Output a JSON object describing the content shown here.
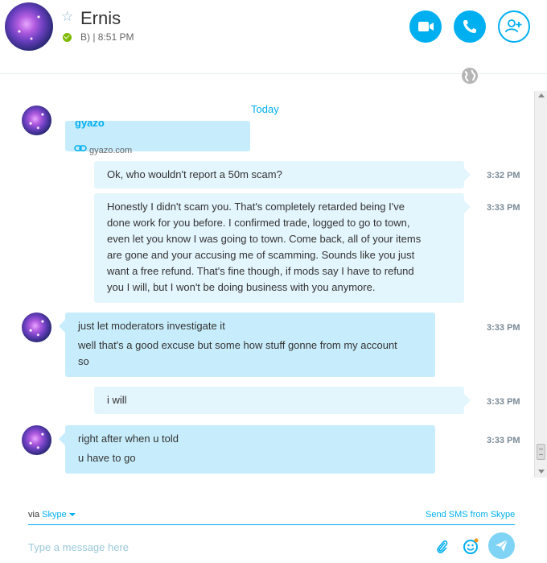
{
  "header": {
    "contact_name": "Ernis",
    "mood": "B) | 8:51 PM",
    "accent_color": "#00aff0",
    "presence_color": "#7fba00",
    "icons": [
      "star-icon",
      "video-icon",
      "phone-icon",
      "add-contact-icon",
      "globe-icon"
    ]
  },
  "conversation": {
    "day_separator": "Today",
    "link_preview": {
      "title": "gyazo",
      "domain": "gyazo.com"
    },
    "messages": [
      {
        "direction": "outgoing",
        "time": "3:32 PM",
        "lines": [
          "Ok, who wouldn't report a 50m scam?"
        ]
      },
      {
        "direction": "outgoing",
        "time": "3:33 PM",
        "lines": [
          "Honestly I didn't scam you. That's completely retarded being I've",
          "done work for you before. I confirmed trade, logged to go to town,",
          "even let you know I was going to town. Come back, all of your items",
          "are gone and your accusing me of scamming. Sounds like you just",
          "want a free refund. That's fine though, if mods say I have to refund",
          "you I will, but I won't be doing business with you anymore."
        ]
      },
      {
        "direction": "incoming",
        "time": "3:33 PM",
        "lines": [
          "just let moderators investigate it",
          "well that's a good excuse but some how stuff gonne from my account",
          "so"
        ]
      },
      {
        "direction": "outgoing",
        "time": "3:33 PM",
        "lines": [
          "i will"
        ]
      },
      {
        "direction": "incoming",
        "time": "3:33 PM",
        "lines": [
          "right after when u told",
          "u have to go"
        ]
      }
    ]
  },
  "footer": {
    "via_label": "via",
    "via_service": "Skype",
    "sms_link": "Send SMS from Skype",
    "input_placeholder": "Type a message here",
    "icons": [
      "attach-icon",
      "emoticon-icon",
      "send-icon"
    ]
  }
}
